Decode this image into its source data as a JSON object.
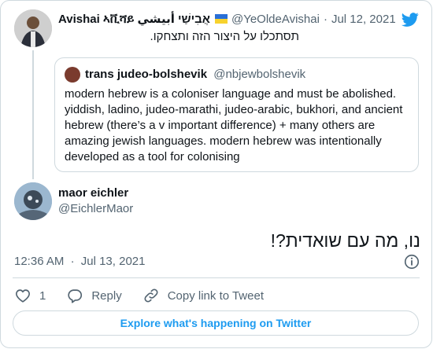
{
  "tweet": {
    "author_name": "Avishai ኣቪሻይ אֲבִישַׁי أبيشي",
    "author_handle": "@YeOldeAvishai",
    "separator": "·",
    "date": "Jul 12, 2021",
    "text": "תסתכלו על היצור הזה ותצחקו.",
    "flag_icon": "ukraine-flag-icon",
    "brand_icon": "twitter-bird-icon",
    "colors": {
      "brand": "#1d9bf0",
      "muted": "#536471",
      "border": "#cfd9de"
    }
  },
  "quoted": {
    "author_name": "trans judeo-bolshevik",
    "author_handle": "@nbjewbolshevik",
    "text": "modern hebrew is a coloniser language and must be abolished. yiddish, ladino, judeo-marathi, judeo-arabic, bukhori, and ancient hebrew (there’s a v important difference) + many others are amazing jewish languages. modern hebrew was intentionally developed as a tool for colonising"
  },
  "reply": {
    "author_name": "maor eichler",
    "author_handle": "@EichlerMaor",
    "text": "נו, מה עם שואדית?!",
    "time": "12:36 AM",
    "separator": "·",
    "date": "Jul 13, 2021"
  },
  "actions": {
    "like_count": "1",
    "reply_label": "Reply",
    "copy_link_label": "Copy link to Tweet"
  },
  "explore_label": "Explore what's happening on Twitter"
}
